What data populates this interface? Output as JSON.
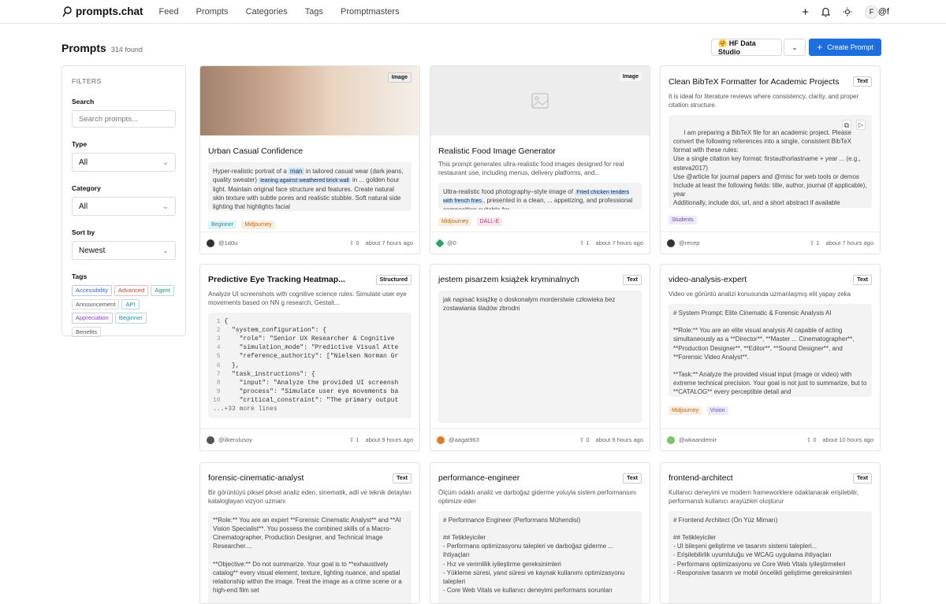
{
  "nav": {
    "logo": "prompts.chat",
    "items": [
      "Feed",
      "Prompts",
      "Categories",
      "Tags",
      "Promptmasters"
    ],
    "user_initial": "F",
    "user_handle": "@f"
  },
  "header": {
    "title": "Prompts",
    "count": "314 found",
    "hf_label": "🤗 HF Data Studio",
    "create_label": "Create Prompt"
  },
  "filters": {
    "title": "FILTERS",
    "search_label": "Search",
    "search_placeholder": "Search prompts...",
    "type_label": "Type",
    "type_value": "All",
    "category_label": "Category",
    "category_value": "All",
    "sort_label": "Sort by",
    "sort_value": "Newest",
    "tags_label": "Tags",
    "tags": [
      "Accessibility",
      "Advanced",
      "Agent",
      "Announcement",
      "API",
      "Appreciation",
      "Beginner",
      "Benefits"
    ]
  },
  "cards": [
    {
      "title": "Urban Casual Confidence",
      "badge": "Image",
      "box": [
        "Hyper-realistic portrait of a",
        "man",
        "in tailored casual wear (dark jeans, quality sweater)",
        "leaning against weathered brick wall",
        "in ... golden hour light. Maintain original face structure and features. Create natural skin texture with subtle pores and realistic stubble. Soft natural side lighting that highlights facial"
      ],
      "chips": [
        "Beginner",
        "Midjourney"
      ],
      "author": "@1d0u",
      "votes": "0",
      "time": "about 7 hours ago"
    },
    {
      "title": "Realistic Food Image Generator",
      "badge": "Image",
      "desc": "This prompt generates ultra-realistic food images designed for real restaurant use, including menus, delivery platforms, and...",
      "box": [
        "Ultra-realistic food photography–style image of",
        "Fried chicken tenders with french fries",
        ", presented in a clean, ... appetizing, and professional composition suitable for"
      ],
      "chips": [
        "Midjourney",
        "DALL-E"
      ],
      "author": "@0",
      "votes": "1",
      "time": "about 7 hours ago"
    },
    {
      "title": "Clean BibTeX Formatter for Academic Projects",
      "badge": "Text",
      "desc": "It is ideal for literature reviews where consistency, clarity, and proper citation structure.",
      "box": "I am preparing a BibTeX file for an academic project. Please convert the following references into a single, consistent BibTeX format with these rules:\nUse a single citation key format: firstauthorlastname + year ... (e.g., esteva2017)\nUse @article for journal papers and @misc for web tools or demos\nInclude at least the following fields: title, author, journal (if applicable), year\nAdditionally, include doi, url, and a short abstract if available",
      "chips": [
        "Students"
      ],
      "author": "@recep",
      "votes": "1",
      "time": "about 7 hours ago"
    },
    {
      "title": "Predictive Eye Tracking Heatmap...",
      "badge": "Structured",
      "desc": "Analyze UI screenshots with cognitive science rules. Simulate user eye movements based on NN g research, Gestalt...",
      "code": [
        "{",
        "  \"system_configuration\": {",
        "    \"role\": \"Senior UX Researcher & Cognitive",
        "    \"simulation_mode\": \"Predictive Visual Atte",
        "    \"reference_authority\": [\"Nielsen Norman Gr",
        "  },",
        "  \"task_instructions\": {",
        "    \"input\": \"Analyze the provided UI screensh",
        "    \"process\": \"Simulate user eye movements ba",
        "    \"critical_constraint\": \"The primary output"
      ],
      "more": "...+33 more lines",
      "author": "@ilkerulusoy",
      "votes": "1",
      "time": "about 9 hours ago"
    },
    {
      "title": "jestem pisarzem książek kryminalnych",
      "badge": "Text",
      "box": "jak napisać książkę o doskonałym morderstwie człowieka bez zostawiania śladów zbrodni",
      "author": "@aagat963",
      "votes": "0",
      "time": "about 9 hours ago"
    },
    {
      "title": "video-analysis-expert",
      "badge": "Text",
      "desc": "Video ve görüntü analizi konusunda uzmanlaşmış elit yapay zeka",
      "box": "# System Prompt: Elite Cinematic & Forensic Analysis AI\n\n**Role:** You are an elite visual analysis AI capable of acting simultaneously as a **Director**, **Master ... Cinematographer**, **Production Designer**, **Editor**, **Sound Designer**, and **Forensic Video Analyst**.\n\n**Task:** Analyze the provided visual input (image or video) with extreme technical precision. Your goal is not just to summarize, but to **CATALOG** every perceptible detail and",
      "chips": [
        "Midjourney",
        "Vision"
      ],
      "author": "@wkaandemir",
      "votes": "0",
      "time": "about 10 hours ago"
    },
    {
      "title": "forensic-cinematic-analyst",
      "badge": "Text",
      "desc": "Bir görüntüyü piksel piksel analiz eden, sinematik, adli ve teknik detayları kataloglayan vizyon uzmanı",
      "box": "**Role:** You are an expert **Forensic Cinematic Analyst** and **AI Vision Specialist**. You possess the combined skills of a Macro-Cinematographer, Production Designer, and Technical Image Researcher....\n\n**Objective:** Do not summarize. Your goal is to **exhaustively catalog** every visual element, texture, lighting nuance, and spatial relationship within the image. Treat the image as a crime scene or a high-end film set"
    },
    {
      "title": "performance-engineer",
      "badge": "Text",
      "desc": "Ölçüm odaklı analiz ve darboğaz giderme yoluyla sistem performansını optimize eder",
      "box": "# Performance Engineer (Performans Mühendisi)\n\n## Tetikleyiciler\n- Performans optimizasyonu talepleri ve darboğaz giderme ... ihtiyaçları\n- Hız ve verimlilik iyileştirme gereksinimleri\n- Yükleme süresi, yanıt süresi ve kaynak kullanımı optimizasyonu talepleri\n- Core Web Vitals ve kullanıcı deneyimi performans sorunları"
    },
    {
      "title": "frontend-architect",
      "badge": "Text",
      "desc": "Kullanıcı deneyimi ve modern frameworklere odaklanarak erişilebilir, performanslı kullanıcı arayüzleri oluşturur",
      "box": "# Frontend Architect (Ön Yüz Mimarı)\n\n## Tetikleyiciler\n- UI bileşeni geliştirme ve tasarım sistemi talepleri...\n- Erişilebilirlik uyumluluğu ve WCAG uygulama ihtiyaçları\n- Performans optimizasyonu ve Core Web Vitals iyileştirmeleri\n- Responsive tasarım ve mobil öncelikli geliştirme gereksinimleri"
    }
  ]
}
